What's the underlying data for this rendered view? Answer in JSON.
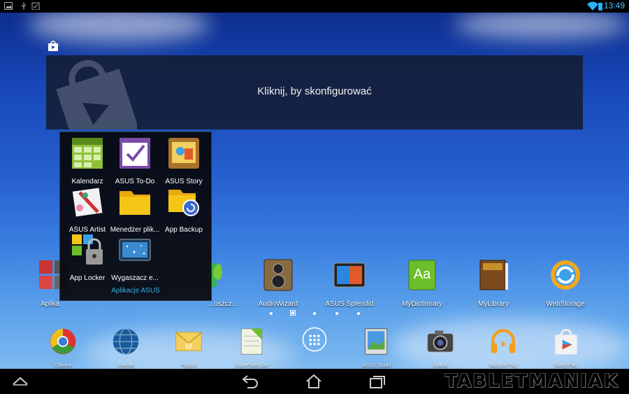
{
  "status_bar": {
    "time": "13:49"
  },
  "widget": {
    "text": "Kliknij, by skonfigurować"
  },
  "folder": {
    "name": "Aplikacje ASUS",
    "apps": [
      {
        "label": "Kalendarz",
        "icon": "calendar-icon"
      },
      {
        "label": "ASUS To-Do",
        "icon": "todo-checkmark-icon"
      },
      {
        "label": "ASUS Story",
        "icon": "photo-story-icon"
      },
      {
        "label": "ASUS Artist",
        "icon": "paintbrush-icon"
      },
      {
        "label": "Menedżer plik...",
        "icon": "folder-icon"
      },
      {
        "label": "App Backup",
        "icon": "backup-folder-icon"
      },
      {
        "label": "App Locker",
        "icon": "padlock-icon"
      },
      {
        "label": "Wygaszacz e...",
        "icon": "screensaver-icon"
      }
    ]
  },
  "home_icons": [
    {
      "label": "Aplika",
      "icon": "asus-apps-folder-icon"
    },
    {
      "label": "...oszcz...",
      "icon": "battery-saver-icon"
    },
    {
      "label": "AudioWizard",
      "icon": "speaker-icon"
    },
    {
      "label": "ASUS Splendid",
      "icon": "splendid-display-icon"
    },
    {
      "label": "MyDictionary",
      "icon": "dictionary-icon"
    },
    {
      "label": "MyLibrary",
      "icon": "book-icon"
    },
    {
      "label": "WebStorage",
      "icon": "cloud-sync-icon"
    }
  ],
  "dock": [
    {
      "label": "Chrome",
      "icon": "chrome-icon"
    },
    {
      "label": "Internet",
      "icon": "globe-icon"
    },
    {
      "label": "Poczta",
      "icon": "mail-icon"
    },
    {
      "label": "SuperNote Lite",
      "icon": "notebook-icon"
    },
    {
      "label": "",
      "icon": "app-drawer-icon"
    },
    {
      "label": "ASUS Studio",
      "icon": "gallery-icon"
    },
    {
      "label": "Aparat",
      "icon": "camera-icon"
    },
    {
      "label": "Muzyka Play",
      "icon": "headphones-icon"
    },
    {
      "label": "Sklep Play",
      "icon": "play-store-icon"
    }
  ],
  "navigation": {
    "buttons": [
      "up-arrow-icon",
      "back-icon",
      "home-icon",
      "recent-apps-icon"
    ]
  },
  "watermark": "TABLETMANIAK"
}
